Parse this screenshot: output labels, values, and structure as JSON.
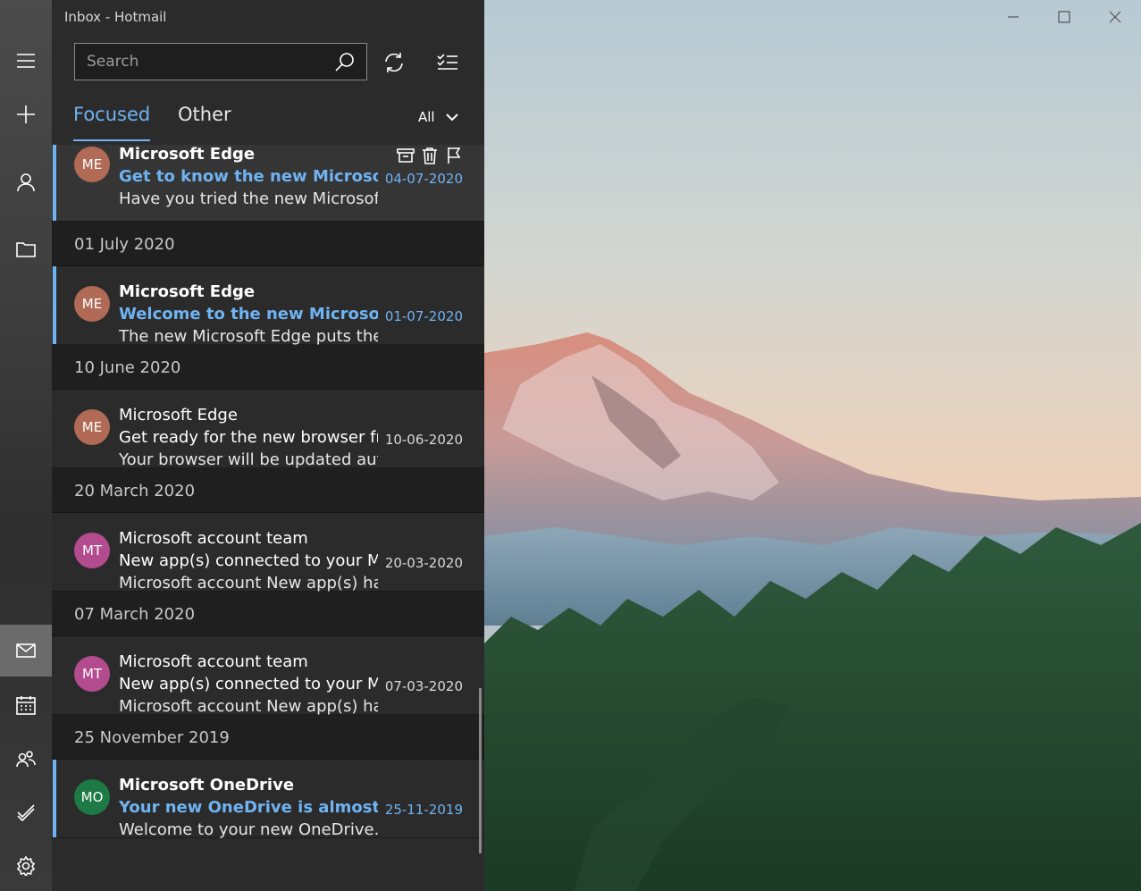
{
  "window": {
    "title": "Inbox - Hotmail"
  },
  "rail": {
    "items": [
      {
        "icon": "hamburger-icon"
      },
      {
        "icon": "plus-icon"
      },
      {
        "icon": "person-icon"
      },
      {
        "icon": "folder-icon"
      },
      {
        "icon": "mail-icon"
      },
      {
        "icon": "calendar-icon"
      },
      {
        "icon": "people-icon"
      },
      {
        "icon": "todo-icon"
      },
      {
        "icon": "gear-icon"
      }
    ]
  },
  "search": {
    "placeholder": "Search"
  },
  "tabs": {
    "focused": "Focused",
    "other": "Other",
    "filter": "All"
  },
  "messages": {
    "m1": {
      "initials": "ME",
      "avatar_color": "#b06a55",
      "sender": "Microsoft Edge",
      "subject": "Get to know the new Microsoft Edge",
      "preview": "Have you tried the new Microsoft Edge",
      "date": "04-07-2020"
    },
    "h1": "01 July 2020",
    "m2": {
      "initials": "ME",
      "avatar_color": "#b06a55",
      "sender": "Microsoft Edge",
      "subject": "Welcome to the new Microsoft Edge",
      "preview": "The new Microsoft Edge puts the web",
      "date": "01-07-2020"
    },
    "h2": "10 June 2020",
    "m3": {
      "initials": "ME",
      "avatar_color": "#b06a55",
      "sender": "Microsoft Edge",
      "subject": "Get ready for the new browser from",
      "preview": "Your browser will be updated automatically",
      "date": "10-06-2020"
    },
    "h3": "20 March 2020",
    "m4": {
      "initials": "MT",
      "avatar_color": "#b34b8f",
      "sender": "Microsoft account team",
      "subject": "New app(s) connected to your Microsoft",
      "preview": "Microsoft account New app(s) have",
      "date": "20-03-2020"
    },
    "h4": "07 March 2020",
    "m5": {
      "initials": "MT",
      "avatar_color": "#b34b8f",
      "sender": "Microsoft account team",
      "subject": "New app(s) connected to your Microsoft",
      "preview": "Microsoft account New app(s) have",
      "date": "07-03-2020"
    },
    "h5": "25 November 2019",
    "m6": {
      "initials": "MO",
      "avatar_color": "#1e7a44",
      "sender": "Microsoft OneDrive",
      "subject": "Your new OneDrive is almost set up",
      "preview": "Welcome to your new OneDrive. There",
      "date": "25-11-2019"
    }
  },
  "colors": {
    "accent": "#6fb3f2",
    "pane_bg": "#2b2b2b",
    "header_bg": "#1f1f1f"
  }
}
